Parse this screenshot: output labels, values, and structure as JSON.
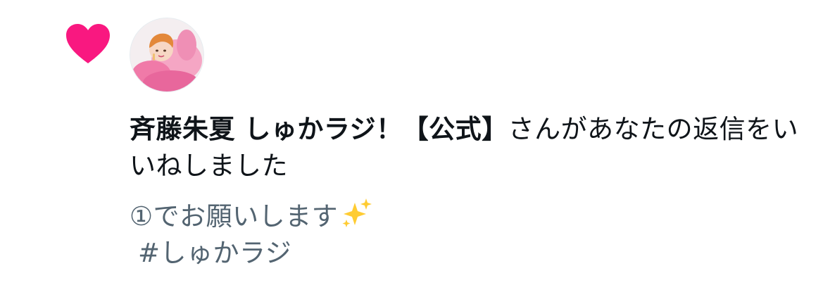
{
  "notification": {
    "type_icon": "heart-icon",
    "type_color": "#f91880",
    "avatar_icon": "user-avatar",
    "actor_name": "斉藤朱夏 しゅかラジ！【公式】",
    "action_text": "さんがあなたの返信をいいねしました"
  },
  "tweet": {
    "text": "①でお願いします",
    "emoji": "sparkles-icon",
    "hashtag": "#しゅかラジ"
  },
  "colors": {
    "text_primary": "#0f1419",
    "text_secondary": "#536471",
    "like_pink": "#f91880",
    "sparkle_gold": "#ffcc33"
  }
}
